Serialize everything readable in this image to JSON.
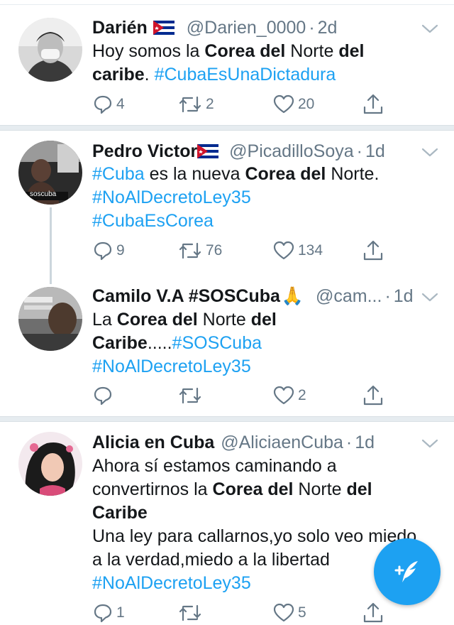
{
  "tweets": [
    {
      "name": "Darién",
      "handle": "@Darien_0000",
      "separator": "·",
      "time": "2d",
      "flag": "cuba-flag-icon",
      "body": {
        "p1": "Hoy somos la ",
        "b1": "Corea del",
        "p2": " Norte ",
        "b2": "del",
        "b3": "caribe",
        "p3": ". ",
        "h1": "#CubaEsUnaDictadura"
      },
      "replies": "4",
      "retweets": "2",
      "likes": "20"
    },
    {
      "name": "Pedro Victor",
      "handle": "@PicadilloSoya",
      "separator": "·",
      "time": "1d",
      "flag": "cuba-flag-icon",
      "avatar_caption": "soscuba",
      "body": {
        "h1": "#Cuba",
        "p1": " es la nueva ",
        "b1": "Corea del",
        "p2": " Norte.",
        "h2": "#NoAlDecretoLey35",
        "h3": "#CubaEsCorea"
      },
      "replies": "9",
      "retweets": "76",
      "likes": "134"
    },
    {
      "name": "Camilo V.A #SOSCuba",
      "emoji": "🙏",
      "handle": "@cam...",
      "separator": "·",
      "time": "1d",
      "body": {
        "p1": "La ",
        "b1": "Corea del",
        "p2": " Norte ",
        "b2": "del",
        "b3": "Caribe",
        "p3": ".....",
        "h1": "#SOSCuba",
        "h2": "#NoAlDecretoLey35"
      },
      "replies": "",
      "retweets": "",
      "likes": "2"
    },
    {
      "name": "Alicia en Cuba",
      "handle": "@AliciaenCuba",
      "separator": "·",
      "time": "1d",
      "body": {
        "l1": "Ahora sí estamos caminando a",
        "p1": "convertirnos la ",
        "b1": "Corea del",
        "p2": " Norte ",
        "b2": "del",
        "b3": "Caribe",
        "l4": "Una ley para callarnos,yo solo veo miedo",
        "l5": "a la verdad,miedo a la libertad",
        "h1": "#NoAlDecretoLey35"
      },
      "replies": "1",
      "retweets": "",
      "likes": "5"
    }
  ],
  "icons": {
    "reply": "reply-icon",
    "retweet": "retweet-icon",
    "like": "heart-icon",
    "share": "share-icon",
    "menu": "chevron-down-icon",
    "compose": "compose-tweet-icon"
  },
  "colors": {
    "accent": "#1da1f2",
    "text": "#14171a",
    "secondary": "#657786",
    "divider": "#e6ecf0"
  }
}
